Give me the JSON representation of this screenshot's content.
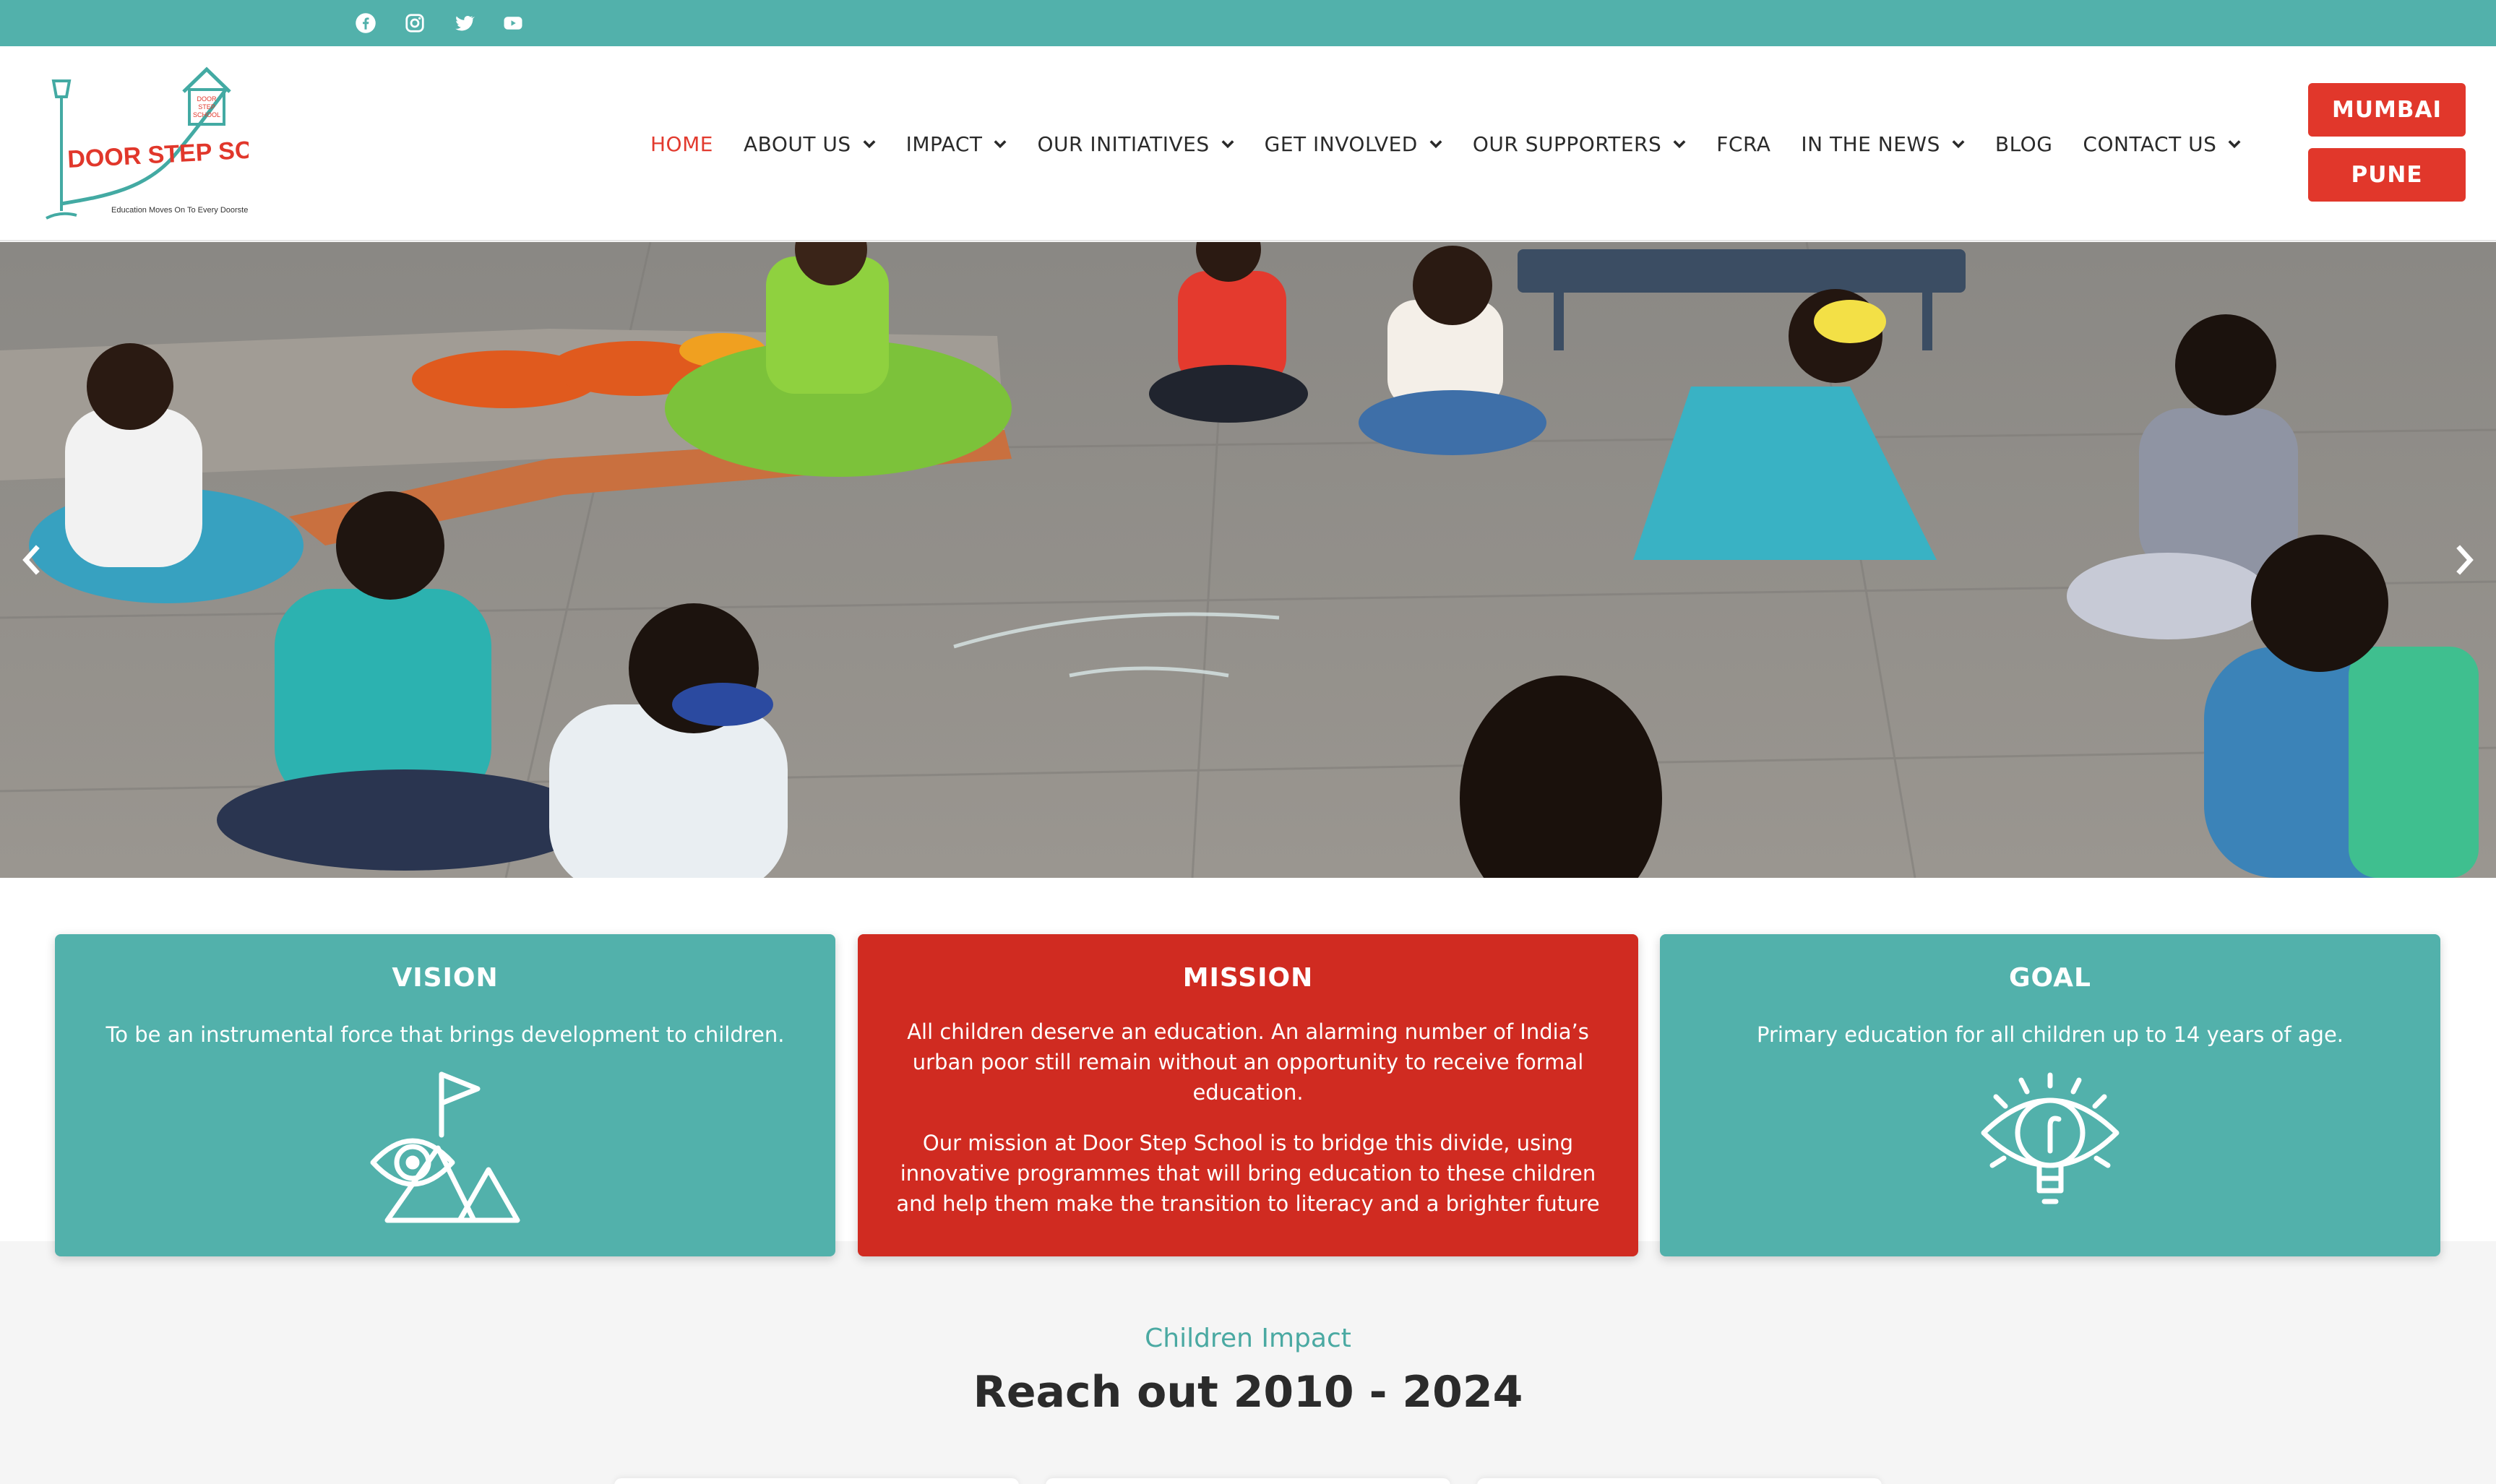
{
  "social": [
    "facebook-icon",
    "instagram-icon",
    "twitter-icon",
    "youtube-icon"
  ],
  "logo": {
    "name": "DOOR STEP SCHOOL",
    "tagline": "Education Moves On To Every Doorstep",
    "house_text": [
      "DOOR",
      "STEP",
      "SCHOOL"
    ]
  },
  "nav": {
    "items": [
      {
        "label": "HOME",
        "active": true,
        "dropdown": false
      },
      {
        "label": "ABOUT US",
        "dropdown": true
      },
      {
        "label": "IMPACT",
        "dropdown": true
      },
      {
        "label": "OUR INITIATIVES",
        "dropdown": true
      },
      {
        "label": "GET INVOLVED",
        "dropdown": true
      },
      {
        "label": "OUR SUPPORTERS",
        "dropdown": true
      },
      {
        "label": "FCRA",
        "dropdown": false
      },
      {
        "label": "IN THE NEWS",
        "dropdown": true
      },
      {
        "label": "BLOG",
        "dropdown": false
      },
      {
        "label": "CONTACT US",
        "dropdown": true
      }
    ]
  },
  "city_buttons": {
    "mumbai": "MUMBAI",
    "pune": "PUNE"
  },
  "hero": {
    "prev_icon": "chevron-left-icon",
    "next_icon": "chevron-right-icon"
  },
  "cards": {
    "vision": {
      "title": "VISION",
      "text": "To be an instrumental force that brings development to children."
    },
    "mission": {
      "title": "MISSION",
      "text1": "All children deserve an education. An alarming number of India’s urban poor still remain without an opportunity to receive formal education.",
      "text2": "Our mission at Door Step School is to bridge this divide, using innovative programmes that will bring education to these children and help them make the transition to literacy and a brighter future"
    },
    "goal": {
      "title": "GOAL",
      "text": "Primary education for all children up to 14 years of age."
    }
  },
  "impact": {
    "subtitle": "Children Impact",
    "title": "Reach out 2010 - 2024"
  },
  "colors": {
    "teal": "#52b1ab",
    "red": "#d02b21",
    "nav_active": "#e23a2e",
    "button": "#e1372b"
  }
}
